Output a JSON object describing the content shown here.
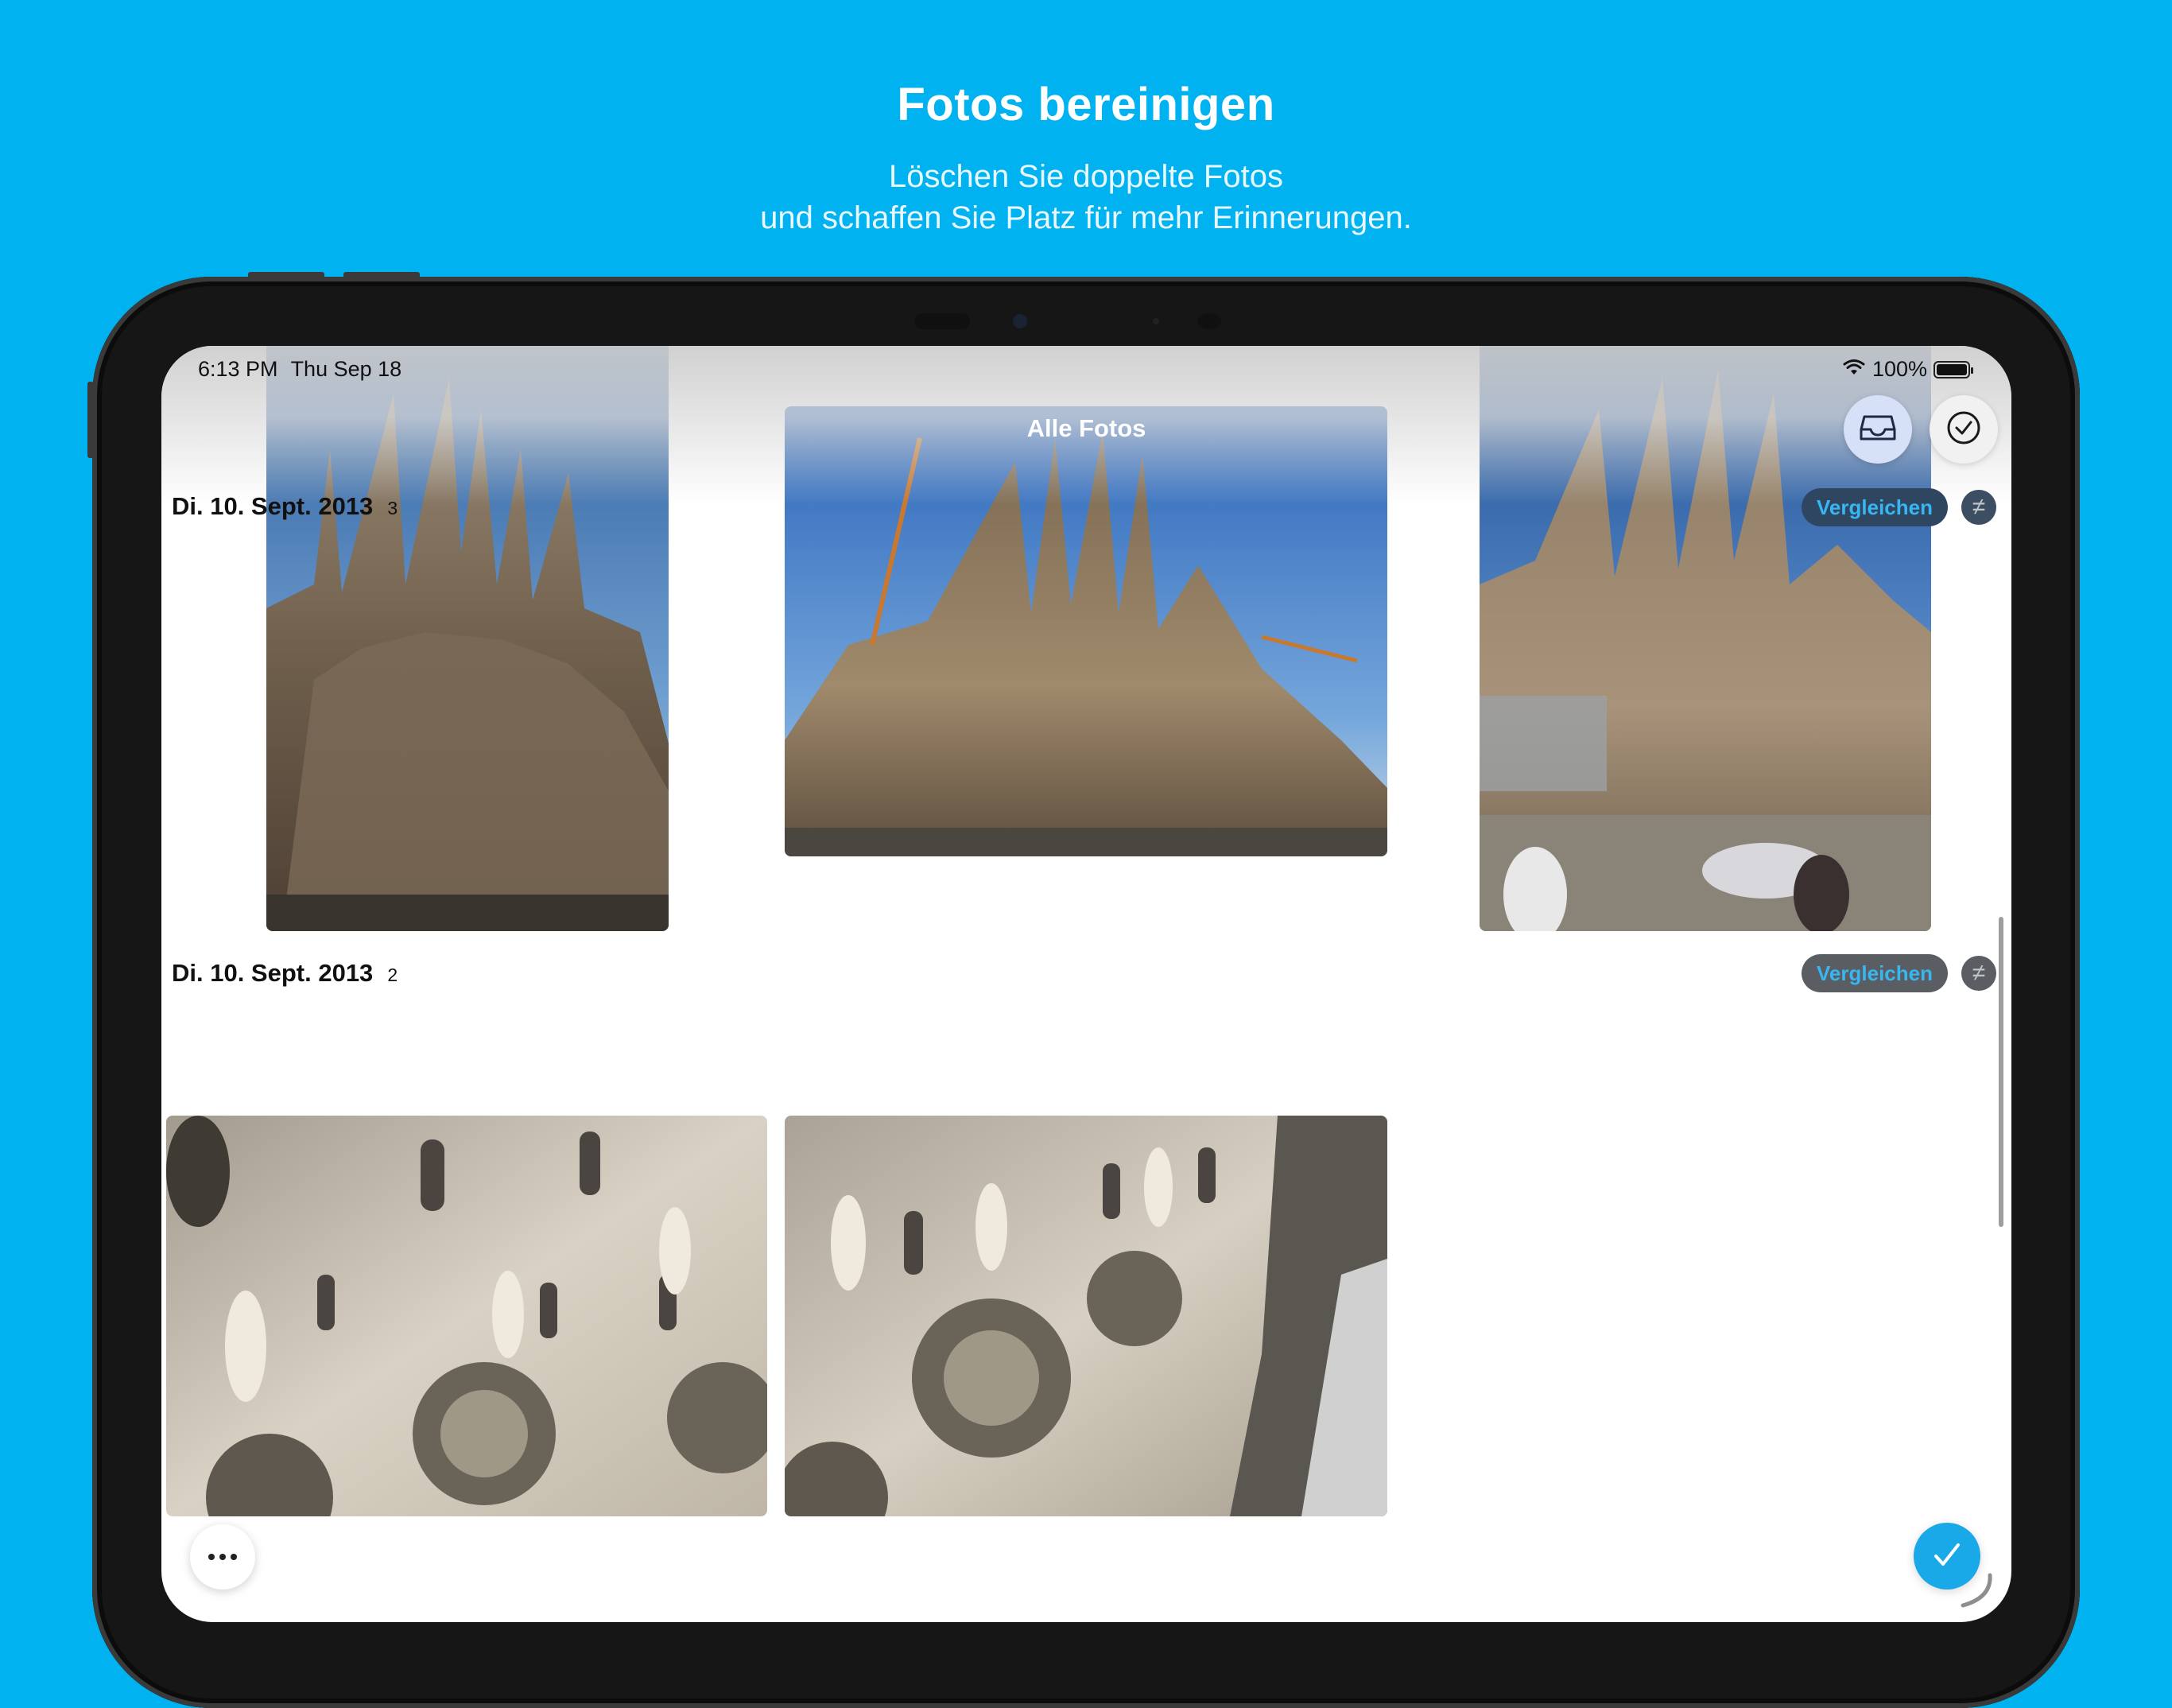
{
  "promo": {
    "title": "Fotos bereinigen",
    "subtitle_line1": "Löschen Sie doppelte Fotos",
    "subtitle_line2": "und schaffen Sie Platz für mehr Erinnerungen."
  },
  "status_bar": {
    "time": "6:13 PM",
    "date": "Thu Sep 18",
    "battery": "100%"
  },
  "nav": {
    "title": "Alle Fotos",
    "inbox_icon": "tray-icon",
    "select_icon": "checkmark-circle-icon"
  },
  "groups": [
    {
      "date": "Di. 10. Sept. 2013",
      "count": "3",
      "compare_label": "Vergleichen",
      "not_equal_symbol": "≠",
      "photos": [
        "sagrada-familia-portrait",
        "sagrada-familia-landscape",
        "sagrada-familia-street"
      ]
    },
    {
      "date": "Di. 10. Sept. 2013",
      "count": "2",
      "compare_label": "Vergleichen",
      "not_equal_symbol": "≠",
      "photos": [
        "facade-detail-left",
        "facade-detail-right"
      ]
    }
  ],
  "colors": {
    "background": "#00b2f0",
    "accent": "#1aa9e8",
    "compare_text": "#38b6f2"
  }
}
